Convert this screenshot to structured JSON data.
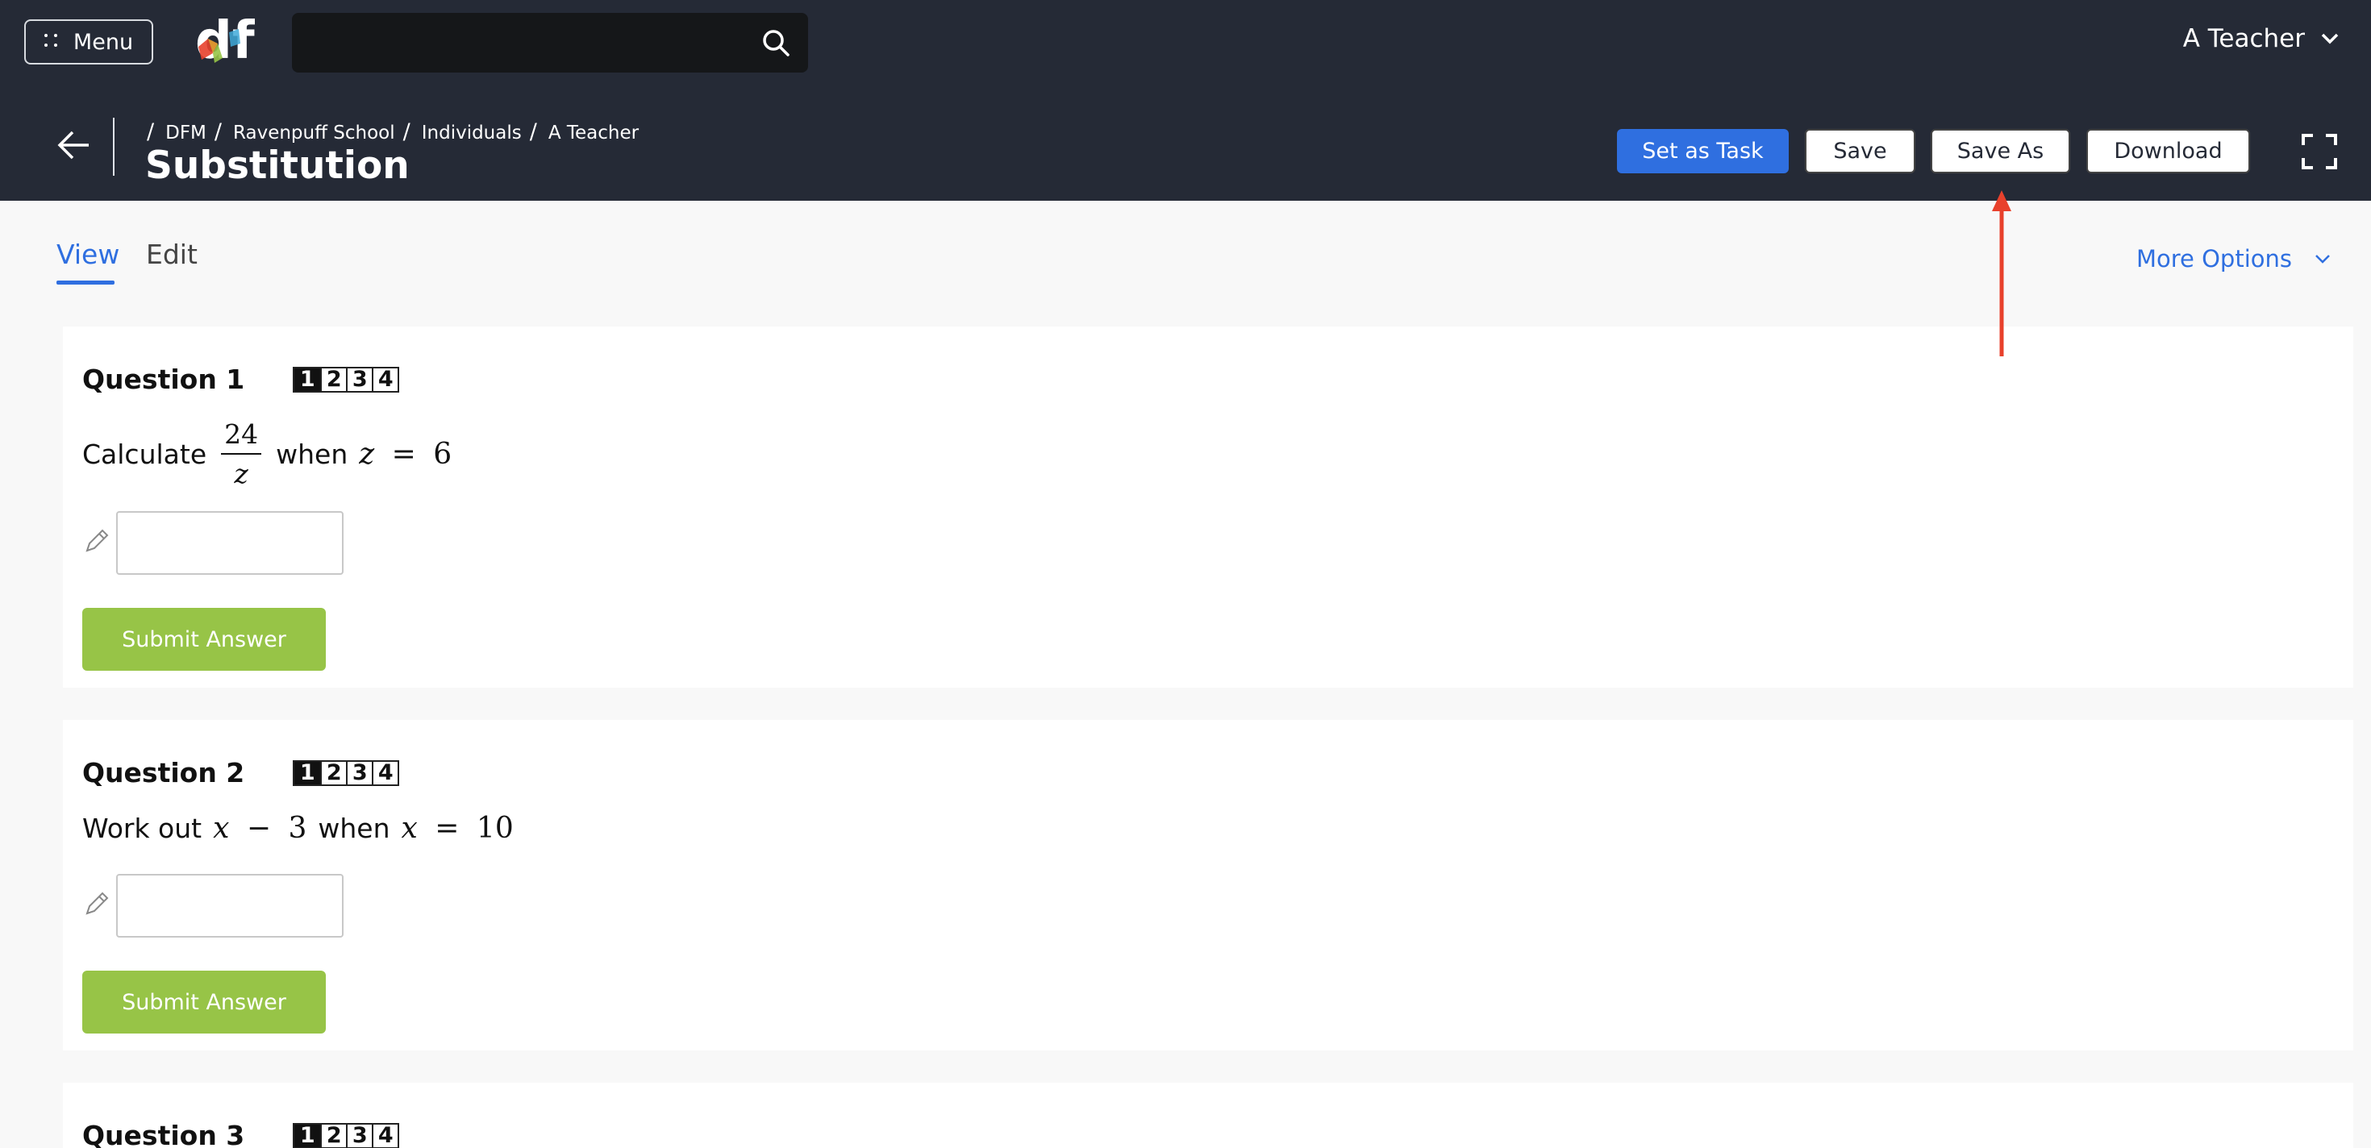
{
  "header": {
    "menu_label": "Menu",
    "logo_text": "df",
    "search": {
      "value": "",
      "placeholder": ""
    },
    "user_name": "A Teacher"
  },
  "breadcrumb": [
    "DFM",
    "Ravenpuff School",
    "Individuals",
    "A Teacher"
  ],
  "page_title": "Substitution",
  "actions": {
    "set_as_task": "Set as Task",
    "save": "Save",
    "save_as": "Save As",
    "download": "Download"
  },
  "tabs": [
    {
      "label": "View",
      "active": true
    },
    {
      "label": "Edit",
      "active": false
    }
  ],
  "more_options": "More Options",
  "questions": [
    {
      "title": "Question 1",
      "levels": [
        "1",
        "2",
        "3",
        "4"
      ],
      "text_before": "Calculate",
      "fraction": {
        "numerator": "24",
        "denominator": "z"
      },
      "text_mid": "when",
      "math_condition": {
        "var": "z",
        "op": "=",
        "value": "6"
      },
      "answer": "",
      "submit_label": "Submit Answer"
    },
    {
      "title": "Question 2",
      "levels": [
        "1",
        "2",
        "3",
        "4"
      ],
      "text_before": "Work out",
      "math_expr": {
        "var": "x",
        "op": "−",
        "value": "3"
      },
      "text_mid": "when",
      "math_condition": {
        "var": "x",
        "op": "=",
        "value": "10"
      },
      "answer": "",
      "submit_label": "Submit Answer"
    },
    {
      "title": "Question 3",
      "levels": [
        "1",
        "2",
        "3",
        "4"
      ]
    }
  ],
  "colors": {
    "header_bg": "#252a36",
    "accent_blue": "#2f6fe0",
    "submit_green": "#97c447",
    "annotation_red": "#e8412c"
  },
  "icons": {
    "menu": "grid-dots-icon",
    "search": "search-icon",
    "user_dropdown": "chevron-down-icon",
    "back": "arrow-left-icon",
    "fullscreen": "fullscreen-icon",
    "more_options": "chevron-down-icon",
    "answer": "pencil-icon"
  }
}
